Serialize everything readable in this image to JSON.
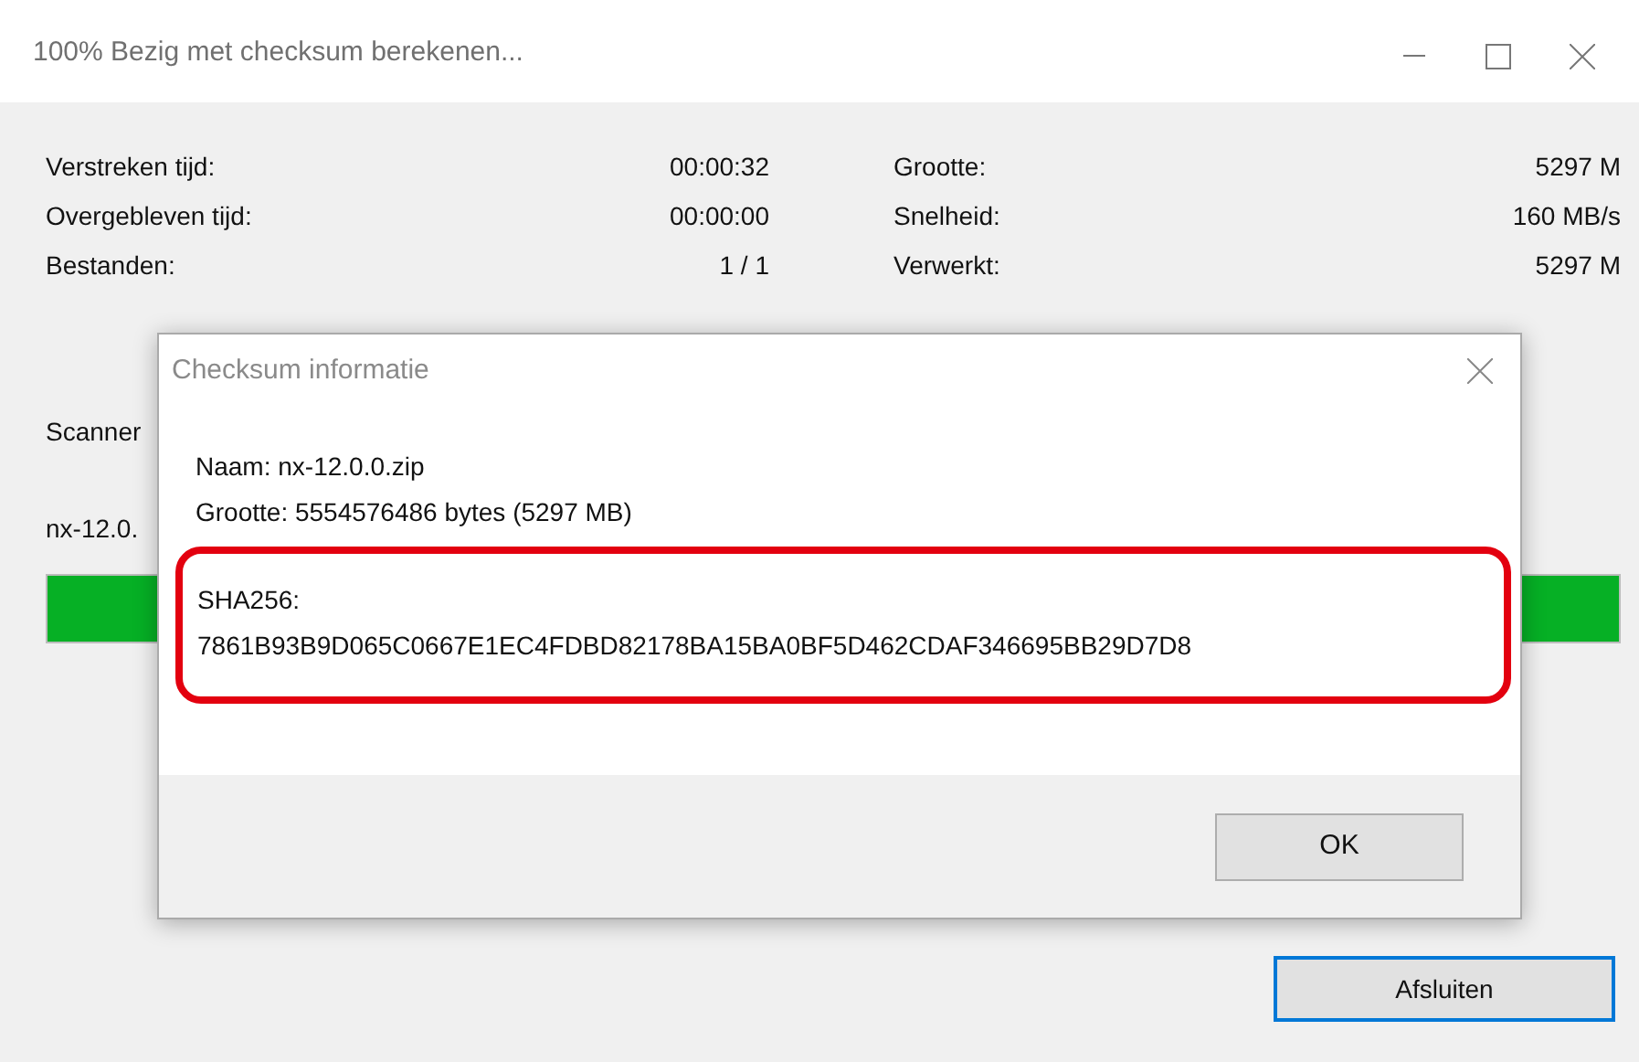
{
  "window": {
    "title": "100% Bezig met checksum berekenen..."
  },
  "stats_left": [
    {
      "label": "Verstreken tijd:",
      "value": "00:00:32"
    },
    {
      "label": "Overgebleven tijd:",
      "value": "00:00:00"
    },
    {
      "label": "Bestanden:",
      "value": "1 / 1"
    }
  ],
  "stats_right": [
    {
      "label": "Grootte:",
      "value": "5297 M"
    },
    {
      "label": "Snelheid:",
      "value": "160 MB/s"
    },
    {
      "label": "Verwerkt:",
      "value": "5297 M"
    }
  ],
  "status": "Scanner",
  "current_file": "nx-12.0.",
  "progress": {
    "level": 1
  },
  "close_button": {
    "label": "Afsluiten",
    "focused": true
  },
  "dialog": {
    "title": "Checksum informatie",
    "name": "Naam: nx-12.0.0.zip",
    "size": "Grootte: 5554576486 bytes (5297 MB)",
    "hash_label": "SHA256:",
    "hash": "7861B93B9D065C0667E1EC4FDBD82178BA15BA0BF5D462CDAF346695BB29D7D8",
    "highlighted": true,
    "ok_button": "OK"
  }
}
